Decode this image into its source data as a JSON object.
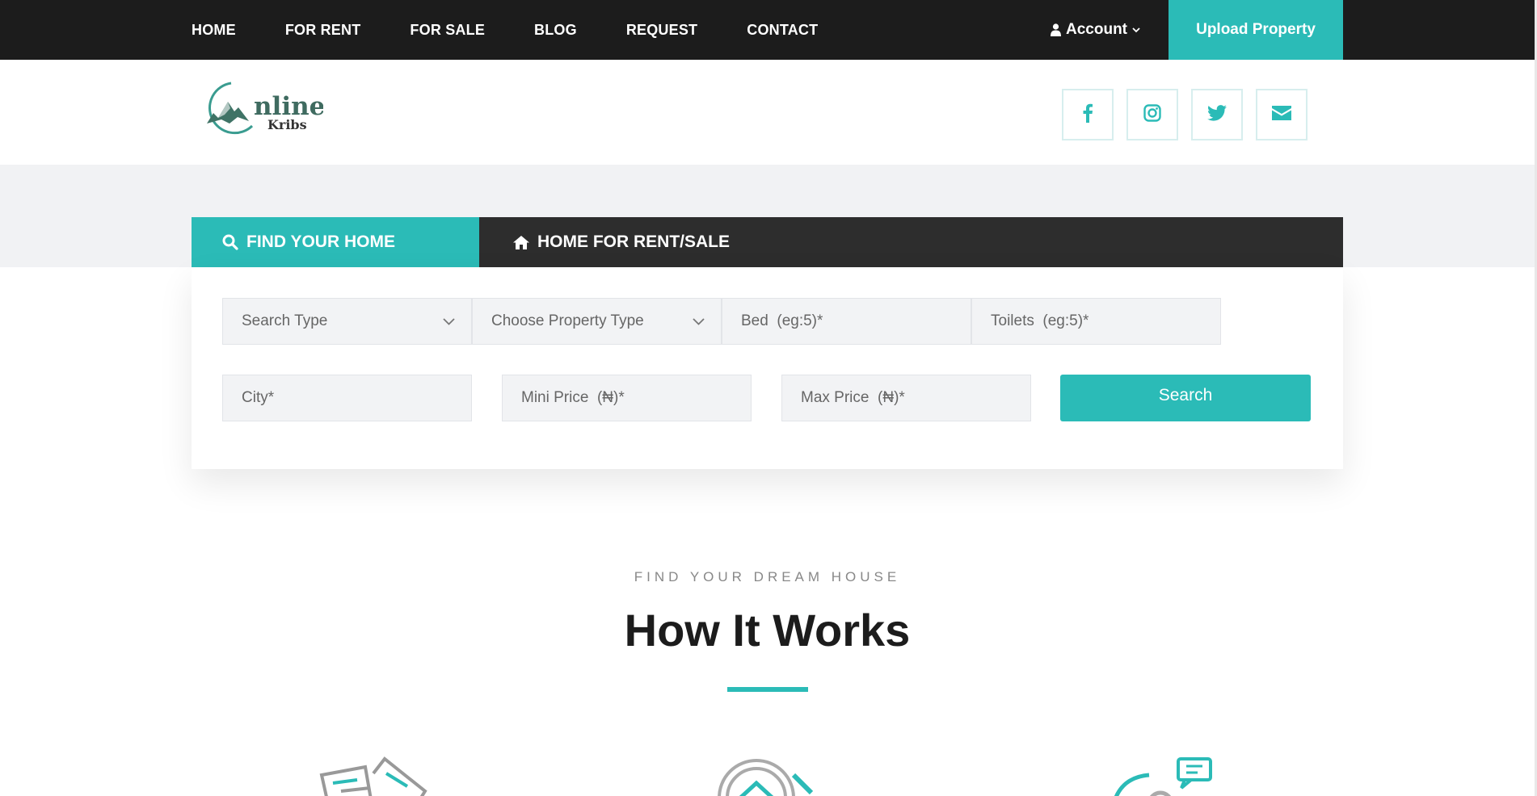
{
  "nav": {
    "items": [
      "HOME",
      "FOR RENT",
      "FOR SALE",
      "BLOG",
      "REQUEST",
      "CONTACT"
    ],
    "account_label": "Account",
    "upload_label": "Upload Property"
  },
  "brand": {
    "logo_word_top": "nline",
    "logo_word_bottom": "Kribs",
    "accent_color": "#2bbbb7",
    "dark_color": "#1c1c1c"
  },
  "socials": [
    "facebook-icon",
    "instagram-icon",
    "twitter-icon",
    "mail-icon"
  ],
  "search": {
    "tab_find": "FIND YOUR HOME",
    "tab_rent": "HOME FOR RENT/SALE",
    "search_type": "Search Type",
    "property_type": "Choose Property Type",
    "bed_placeholder": "Bed  (eg:5)*",
    "toilets_placeholder": "Toilets  (eg:5)*",
    "city_placeholder": "City*",
    "min_price_placeholder": "Mini Price  (₦)*",
    "max_price_placeholder": "Max Price  (₦)*",
    "button": "Search"
  },
  "how": {
    "eyebrow": "FIND YOUR DREAM HOUSE",
    "title": "How It Works"
  }
}
